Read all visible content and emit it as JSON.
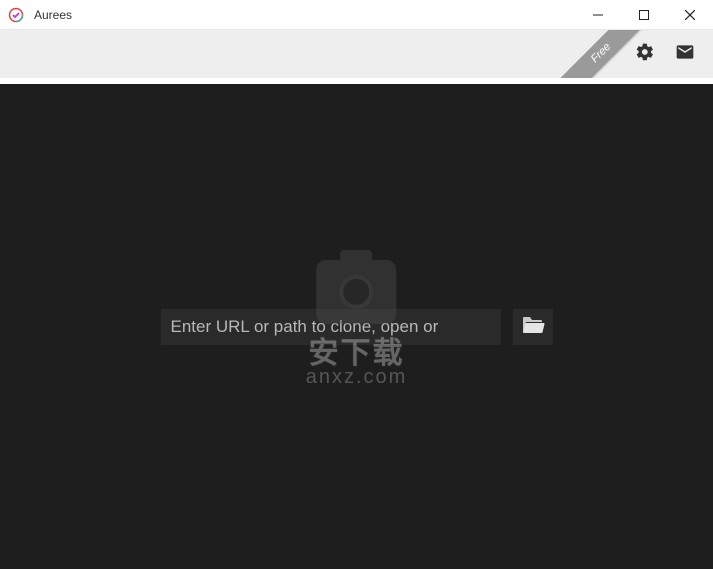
{
  "titlebar": {
    "app_name": "Aurees"
  },
  "toolbar": {
    "free_label": "Free"
  },
  "main": {
    "url_placeholder": "Enter URL or path to clone, open or"
  },
  "watermark": {
    "text": "安下载",
    "url": "anxz.com"
  }
}
